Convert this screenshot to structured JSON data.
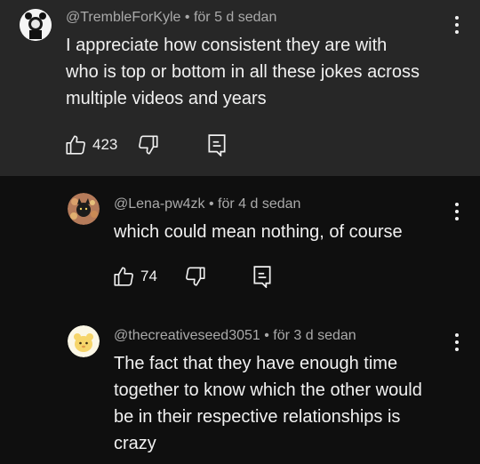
{
  "comments": [
    {
      "author": "@TrembleForKyle",
      "time": " • för 5 d sedan",
      "text_lines": [
        "I appreciate how consistent they are with",
        "who is top or bottom in all these jokes across",
        "multiple videos and years"
      ],
      "likes": "423"
    },
    {
      "author": "@Lena-pw4zk",
      "time": " • för 4 d sedan",
      "text_lines": [
        "which could mean nothing, of course"
      ],
      "likes": "74"
    },
    {
      "author": "@thecreativeseed3051",
      "time": " • för 3 d sedan",
      "text_lines": [
        "The fact that they have enough time",
        "together to know which the other would",
        "be in their respective relationships is",
        "crazy"
      ]
    }
  ],
  "icons": {
    "like": "thumb-up-icon",
    "dislike": "thumb-down-icon",
    "reply": "reply-icon",
    "more": "more-vert-icon"
  },
  "colors": {
    "highlighted_bg": "#272727",
    "bg": "#0f0f0f",
    "meta_text": "#aaaaaa",
    "text": "#f1f1f1"
  }
}
